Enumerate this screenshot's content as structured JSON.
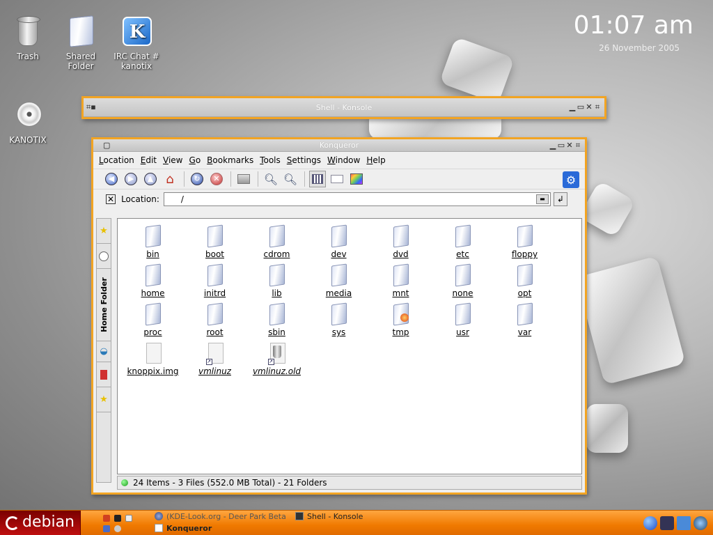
{
  "desktop": {
    "icons": [
      {
        "label": "Trash",
        "icon": "trash-icon"
      },
      {
        "label": "Shared\nFolder",
        "icon": "folder-icon"
      },
      {
        "label": "IRC Chat #\nkanotix",
        "icon": "irc-chat-icon"
      },
      {
        "label": "KANOTIX",
        "icon": "cdrom-icon"
      }
    ],
    "irc_letter": "K",
    "clock": {
      "time": "01:07 am",
      "date": "26 November 2005"
    }
  },
  "konsole": {
    "title": "Shell - Konsole"
  },
  "konqueror": {
    "title": "Konqueror",
    "menu": [
      "Location",
      "Edit",
      "View",
      "Go",
      "Bookmarks",
      "Tools",
      "Settings",
      "Window",
      "Help"
    ],
    "toolbar": [
      "back-icon",
      "forward-icon",
      "up-icon",
      "home-icon",
      "reload-icon",
      "stop-icon",
      "print-icon",
      "zoom-in-icon",
      "zoom-out-icon",
      "icon-view-icon",
      "list-view-icon",
      "image-view-icon",
      "settings-icon"
    ],
    "location": {
      "label": "Location:",
      "value": "/"
    },
    "sidebar": {
      "tabs": [
        "bookmarks-star-icon",
        "history-icon",
        "home-folder-icon",
        "network-icon",
        "services-icon",
        "bookmarks-icon"
      ],
      "home_folder_label": "Home Folder"
    },
    "files": [
      {
        "name": "bin",
        "type": "folder"
      },
      {
        "name": "boot",
        "type": "folder"
      },
      {
        "name": "cdrom",
        "type": "folder"
      },
      {
        "name": "dev",
        "type": "folder"
      },
      {
        "name": "dvd",
        "type": "folder"
      },
      {
        "name": "etc",
        "type": "folder"
      },
      {
        "name": "floppy",
        "type": "folder"
      },
      {
        "name": "home",
        "type": "folder"
      },
      {
        "name": "initrd",
        "type": "folder"
      },
      {
        "name": "lib",
        "type": "folder"
      },
      {
        "name": "media",
        "type": "folder"
      },
      {
        "name": "mnt",
        "type": "folder"
      },
      {
        "name": "none",
        "type": "folder"
      },
      {
        "name": "opt",
        "type": "folder"
      },
      {
        "name": "proc",
        "type": "folder"
      },
      {
        "name": "root",
        "type": "folder"
      },
      {
        "name": "sbin",
        "type": "folder"
      },
      {
        "name": "sys",
        "type": "folder"
      },
      {
        "name": "tmp",
        "type": "folder-special"
      },
      {
        "name": "usr",
        "type": "folder"
      },
      {
        "name": "var",
        "type": "folder"
      },
      {
        "name": "knoppix.img",
        "type": "file"
      },
      {
        "name": "vmlinuz",
        "type": "link"
      },
      {
        "name": "vmlinuz.old",
        "type": "link-trash"
      }
    ],
    "status": "24 Items - 3 Files (552.0 MB Total) - 21 Folders"
  },
  "taskbar": {
    "start_label": "debian",
    "tasks": [
      {
        "label": "(KDE-Look.org - Deer Park Beta",
        "active": false
      },
      {
        "label": "Shell - Konsole",
        "active": false
      },
      {
        "label": "Konqueror",
        "active": true
      }
    ],
    "accent": "#f07a00"
  }
}
